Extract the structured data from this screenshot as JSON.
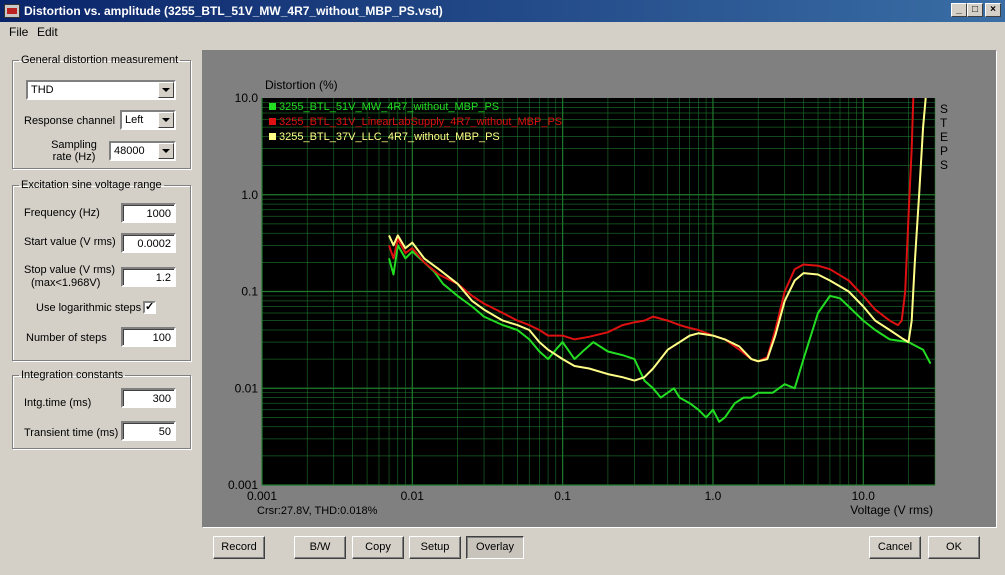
{
  "window": {
    "title": "Distortion vs. amplitude (3255_BTL_51V_MW_4R7_without_MBP_PS.vsd)",
    "controls": [
      "_",
      "□",
      "×"
    ]
  },
  "menu": [
    "File",
    "Edit"
  ],
  "general": {
    "legend": "General distortion measurement",
    "measure": "THD",
    "response_label": "Response channel",
    "response_value": "Left",
    "sampling_label": "Sampling rate (Hz)",
    "sampling_value": "48000"
  },
  "excitation": {
    "legend": "Excitation sine voltage range",
    "freq_label": "Frequency (Hz)",
    "freq_value": "1000",
    "start_label": "Start value (V rms)",
    "start_value": "0.0002",
    "stop_label": "Stop value (V rms)",
    "stop_sub": "(max<1.968V)",
    "stop_value": "1.2",
    "log_label": "Use logarithmic steps",
    "log_checked": "✓",
    "steps_label": "Number of steps",
    "steps_value": "100"
  },
  "integration": {
    "legend": "Integration constants",
    "intg_label": "Intg.time (ms)",
    "intg_value": "300",
    "trans_label": "Transient time (ms)",
    "trans_value": "50"
  },
  "buttons": {
    "record": "Record",
    "bw": "B/W",
    "copy": "Copy",
    "setup": "Setup",
    "overlay": "Overlay",
    "cancel": "Cancel",
    "ok": "OK"
  },
  "plot": {
    "cursor_text": "Crsr:27.8V, THD:0.018%",
    "steps_label": "STEPS"
  },
  "chart_data": {
    "type": "line",
    "title": "",
    "ylabel": "Distortion (%)",
    "xlabel": "Voltage (V rms)",
    "xscale": "log",
    "yscale": "log",
    "xlim": [
      0.001,
      30
    ],
    "ylim": [
      0.001,
      10
    ],
    "x_ticks": [
      "0.001",
      "0.01",
      "0.1",
      "1.0",
      "10.0"
    ],
    "y_ticks": [
      "10.0",
      "1.0",
      "0.1",
      "0.01",
      "0.001"
    ],
    "grid": true,
    "legend_position": "top-left",
    "colors": {
      "background": "#000000",
      "grid": "#1f7a2c"
    },
    "series": [
      {
        "name": "3255_BTL_51V_MW_4R7_without_MBP_PS",
        "color": "#22dd22",
        "points": [
          [
            0.007,
            0.22
          ],
          [
            0.0075,
            0.15
          ],
          [
            0.008,
            0.3
          ],
          [
            0.009,
            0.22
          ],
          [
            0.01,
            0.26
          ],
          [
            0.012,
            0.2
          ],
          [
            0.014,
            0.16
          ],
          [
            0.016,
            0.12
          ],
          [
            0.02,
            0.09
          ],
          [
            0.025,
            0.07
          ],
          [
            0.03,
            0.055
          ],
          [
            0.04,
            0.045
          ],
          [
            0.05,
            0.04
          ],
          [
            0.06,
            0.032
          ],
          [
            0.07,
            0.024
          ],
          [
            0.08,
            0.02
          ],
          [
            0.09,
            0.025
          ],
          [
            0.1,
            0.03
          ],
          [
            0.12,
            0.02
          ],
          [
            0.14,
            0.025
          ],
          [
            0.16,
            0.03
          ],
          [
            0.2,
            0.024
          ],
          [
            0.25,
            0.022
          ],
          [
            0.3,
            0.02
          ],
          [
            0.35,
            0.012
          ],
          [
            0.4,
            0.01
          ],
          [
            0.45,
            0.008
          ],
          [
            0.5,
            0.009
          ],
          [
            0.55,
            0.01
          ],
          [
            0.6,
            0.008
          ],
          [
            0.7,
            0.007
          ],
          [
            0.8,
            0.006
          ],
          [
            0.9,
            0.005
          ],
          [
            1.0,
            0.006
          ],
          [
            1.1,
            0.0045
          ],
          [
            1.2,
            0.005
          ],
          [
            1.4,
            0.007
          ],
          [
            1.6,
            0.008
          ],
          [
            1.8,
            0.008
          ],
          [
            2.0,
            0.009
          ],
          [
            2.5,
            0.009
          ],
          [
            3.0,
            0.011
          ],
          [
            3.5,
            0.01
          ],
          [
            4.0,
            0.02
          ],
          [
            5.0,
            0.06
          ],
          [
            6.0,
            0.09
          ],
          [
            7.0,
            0.085
          ],
          [
            8.0,
            0.07
          ],
          [
            10.0,
            0.05
          ],
          [
            12.0,
            0.04
          ],
          [
            15.0,
            0.032
          ],
          [
            20.0,
            0.03
          ],
          [
            25.0,
            0.025
          ],
          [
            28.0,
            0.018
          ]
        ]
      },
      {
        "name": "3255_BTL_31V_LinearLabSupply_4R7_without_MBP_PS",
        "color": "#dd1111",
        "points": [
          [
            0.007,
            0.3
          ],
          [
            0.0075,
            0.22
          ],
          [
            0.008,
            0.35
          ],
          [
            0.009,
            0.25
          ],
          [
            0.01,
            0.28
          ],
          [
            0.012,
            0.2
          ],
          [
            0.015,
            0.15
          ],
          [
            0.02,
            0.12
          ],
          [
            0.025,
            0.09
          ],
          [
            0.03,
            0.075
          ],
          [
            0.04,
            0.06
          ],
          [
            0.05,
            0.05
          ],
          [
            0.06,
            0.045
          ],
          [
            0.07,
            0.04
          ],
          [
            0.08,
            0.035
          ],
          [
            0.1,
            0.035
          ],
          [
            0.12,
            0.032
          ],
          [
            0.15,
            0.034
          ],
          [
            0.2,
            0.038
          ],
          [
            0.25,
            0.045
          ],
          [
            0.3,
            0.048
          ],
          [
            0.35,
            0.05
          ],
          [
            0.4,
            0.055
          ],
          [
            0.5,
            0.05
          ],
          [
            0.6,
            0.045
          ],
          [
            0.7,
            0.042
          ],
          [
            0.8,
            0.04
          ],
          [
            1.0,
            0.035
          ],
          [
            1.2,
            0.032
          ],
          [
            1.5,
            0.025
          ],
          [
            1.8,
            0.02
          ],
          [
            2.0,
            0.019
          ],
          [
            2.3,
            0.021
          ],
          [
            2.6,
            0.04
          ],
          [
            3.0,
            0.1
          ],
          [
            3.5,
            0.17
          ],
          [
            4.0,
            0.19
          ],
          [
            5.0,
            0.185
          ],
          [
            6.0,
            0.17
          ],
          [
            8.0,
            0.13
          ],
          [
            10.0,
            0.09
          ],
          [
            12.0,
            0.065
          ],
          [
            15.0,
            0.05
          ],
          [
            17.0,
            0.045
          ],
          [
            18.0,
            0.05
          ],
          [
            19.0,
            0.1
          ],
          [
            20.0,
            0.6
          ],
          [
            21.0,
            3.0
          ],
          [
            21.5,
            10.0
          ]
        ]
      },
      {
        "name": "3255_BTL_37V_LLC_4R7_without_MBP_PS",
        "color": "#ffff88",
        "points": [
          [
            0.007,
            0.38
          ],
          [
            0.0075,
            0.3
          ],
          [
            0.008,
            0.38
          ],
          [
            0.009,
            0.28
          ],
          [
            0.01,
            0.32
          ],
          [
            0.012,
            0.22
          ],
          [
            0.015,
            0.17
          ],
          [
            0.02,
            0.12
          ],
          [
            0.025,
            0.08
          ],
          [
            0.03,
            0.065
          ],
          [
            0.04,
            0.05
          ],
          [
            0.05,
            0.045
          ],
          [
            0.06,
            0.04
          ],
          [
            0.07,
            0.03
          ],
          [
            0.08,
            0.025
          ],
          [
            0.1,
            0.02
          ],
          [
            0.12,
            0.017
          ],
          [
            0.15,
            0.016
          ],
          [
            0.2,
            0.014
          ],
          [
            0.25,
            0.013
          ],
          [
            0.3,
            0.012
          ],
          [
            0.35,
            0.013
          ],
          [
            0.4,
            0.016
          ],
          [
            0.5,
            0.025
          ],
          [
            0.6,
            0.03
          ],
          [
            0.7,
            0.035
          ],
          [
            0.8,
            0.037
          ],
          [
            1.0,
            0.035
          ],
          [
            1.2,
            0.032
          ],
          [
            1.5,
            0.027
          ],
          [
            1.8,
            0.02
          ],
          [
            2.0,
            0.019
          ],
          [
            2.3,
            0.02
          ],
          [
            2.6,
            0.035
          ],
          [
            3.0,
            0.08
          ],
          [
            3.5,
            0.13
          ],
          [
            4.0,
            0.155
          ],
          [
            5.0,
            0.15
          ],
          [
            6.0,
            0.13
          ],
          [
            8.0,
            0.1
          ],
          [
            10.0,
            0.07
          ],
          [
            12.0,
            0.05
          ],
          [
            15.0,
            0.04
          ],
          [
            18.0,
            0.033
          ],
          [
            20.0,
            0.03
          ],
          [
            21.0,
            0.05
          ],
          [
            22.0,
            0.2
          ],
          [
            23.5,
            1.0
          ],
          [
            25.0,
            5.0
          ],
          [
            26.0,
            10.0
          ]
        ]
      }
    ]
  }
}
